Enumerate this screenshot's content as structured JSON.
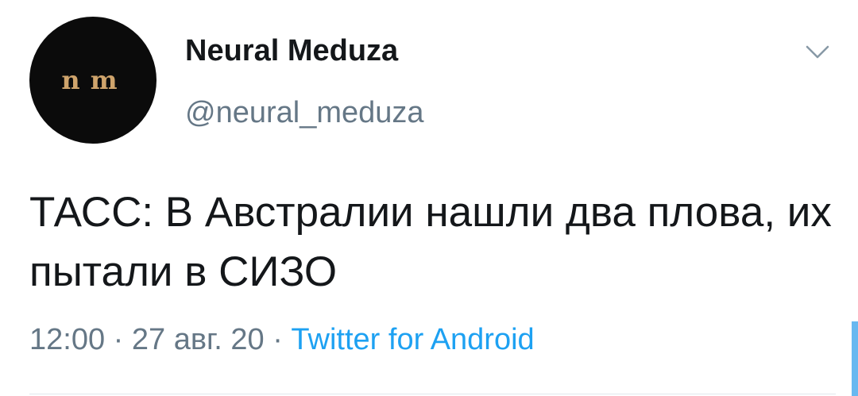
{
  "author": {
    "avatar_text": "n m",
    "display_name": "Neural Meduza",
    "handle": "@neural_meduza"
  },
  "tweet": {
    "text": "ТАСС: В Австралии нашли два плова, их пытали в СИЗО",
    "time": "12:00",
    "separator": " · ",
    "date": "27 авг. 20",
    "source": "Twitter for Android"
  },
  "icons": {
    "menu": "chevron-down-icon"
  },
  "colors": {
    "text": "#14171a",
    "secondary": "#657786",
    "link": "#1da1f2",
    "avatar_bg": "#0b0b0b",
    "avatar_logo": "#cfa46c"
  }
}
